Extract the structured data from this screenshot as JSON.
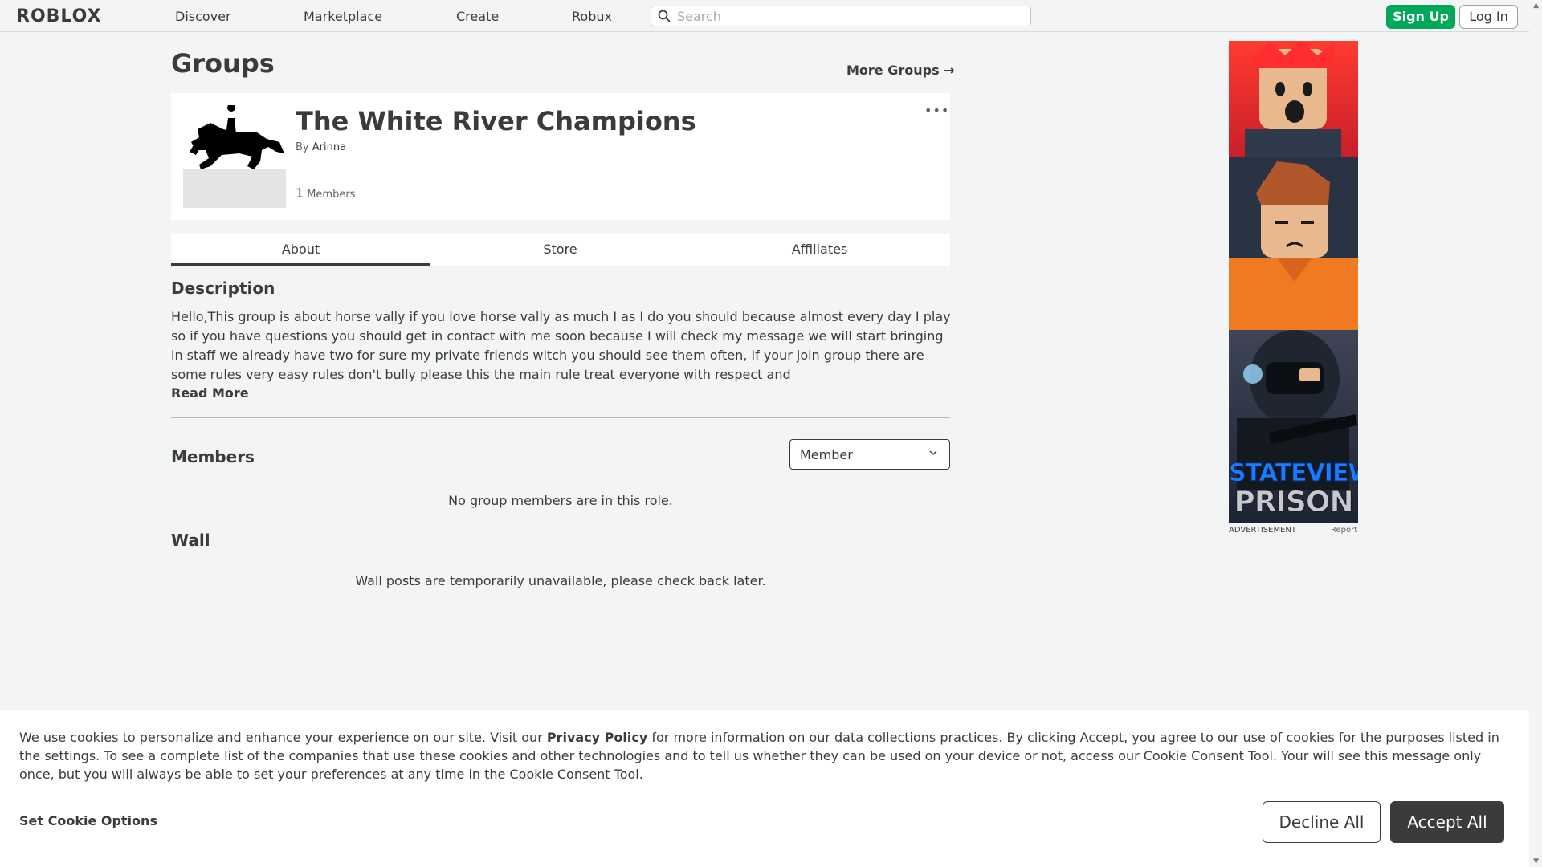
{
  "header": {
    "logo": "ROBLOX",
    "nav": [
      "Discover",
      "Marketplace",
      "Create",
      "Robux"
    ],
    "search_placeholder": "Search",
    "signup_label": "Sign Up",
    "login_label": "Log In"
  },
  "page": {
    "title": "Groups",
    "more_groups": "More Groups →"
  },
  "group": {
    "name": "The White River Champions",
    "by_label": "By",
    "owner": "Arinna",
    "member_count": "1",
    "members_label": "Members",
    "menu": "•••"
  },
  "tabs": [
    "About",
    "Store",
    "Affiliates"
  ],
  "about": {
    "description_title": "Description",
    "description": "Hello,This group is about horse vally if you love horse vally as much I as I do you should because almost every day I play so if you have questions you should get in contact with me soon because I will check my message we will start bringing in staff we already have two for sure my private friends witch you should see them often, If your join group there are some rules very easy rules don't bully please this the main rule treat everyone with respect and",
    "read_more": "Read More",
    "members_title": "Members",
    "role_selected": "Member",
    "no_members": "No group members are in this role.",
    "wall_title": "Wall",
    "wall_unavailable": "Wall posts are temporarily unavailable, please check back later."
  },
  "ad": {
    "label": "ADVERTISEMENT",
    "report": "Report",
    "text_line1": "STATEVIEW",
    "text_line2": "PRISON"
  },
  "cookie": {
    "text_before": "We use cookies to personalize and enhance your experience on our site. Visit our ",
    "privacy_link": "Privacy Policy",
    "text_after": " for more information on our data collections practices. By clicking Accept, you agree to our use of cookies for the purposes listed in the settings. To see a complete list of the companies that use these cookies and other technologies and to tell us whether they can be used on your device or not, access our Cookie Consent Tool. Your will see this message only once, but you will always be able to set your preferences at any time in the Cookie Consent Tool.",
    "set_options": "Set Cookie Options",
    "decline": "Decline All",
    "accept": "Accept All"
  },
  "colors": {
    "signup_green": "#00a85a",
    "text_dark": "#393b3d",
    "background": "#f2f4f5"
  }
}
